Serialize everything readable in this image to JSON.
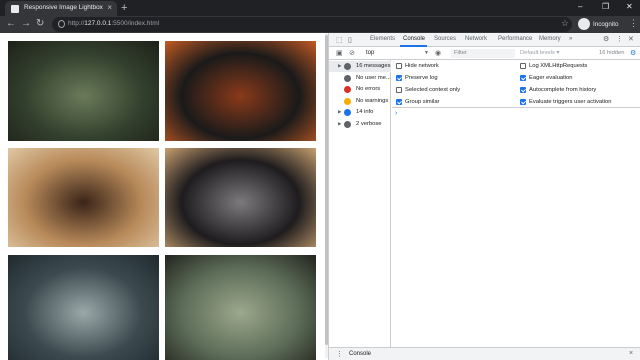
{
  "browser": {
    "tab_title": "Responsive Image Lightbox | Co",
    "tab_close": "×",
    "new_tab": "+",
    "window_controls": [
      "–",
      "❐",
      "✕"
    ],
    "nav": {
      "back": "←",
      "forward": "→",
      "reload": "↻"
    },
    "url_prefix": "http://",
    "url_host": "127.0.0.1",
    "url_rest": ":5500/index.html",
    "star_icon": "☆",
    "profile_label": "Incognito",
    "menu_icon": "⋮"
  },
  "gallery": {
    "images": [
      {
        "name": "backpack-photo",
        "colors": [
          "#33402e",
          "#6a7b59",
          "#1d2118"
        ]
      },
      {
        "name": "camera-on-leaves-photo",
        "colors": [
          "#1a1a1a",
          "#8a3a1a",
          "#c25a24"
        ]
      },
      {
        "name": "headphones-tablet-photo",
        "colors": [
          "#b88a5a",
          "#3a2418",
          "#e0c8a4"
        ]
      },
      {
        "name": "watch-photo",
        "colors": [
          "#1e1c1e",
          "#7c7a7c",
          "#c8a070"
        ]
      },
      {
        "name": "sneakers-in-stream-photo",
        "colors": [
          "#3c4a50",
          "#9aa8a8",
          "#1f2a2e"
        ]
      },
      {
        "name": "vintage-camera-on-log-photo",
        "colors": [
          "#5c6c58",
          "#9ca88c",
          "#22241e"
        ]
      }
    ]
  },
  "devtools": {
    "tabs": [
      "Elements",
      "Console",
      "Sources",
      "Network",
      "Performance",
      "Memory",
      "»"
    ],
    "active_tab": "Console",
    "context": "top",
    "filter_placeholder": "Filter",
    "levels": "Default levels ▾",
    "hidden_count": "16 hidden",
    "sidebar": [
      {
        "label": "16 messages",
        "icon": "list-icon",
        "color": "#5f6368"
      },
      {
        "label": "No user me...",
        "icon": "user-icon",
        "color": "#5f6368"
      },
      {
        "label": "No errors",
        "icon": "error-icon",
        "color": "#d93025"
      },
      {
        "label": "No warnings",
        "icon": "warning-icon",
        "color": "#f9ab00"
      },
      {
        "label": "14 info",
        "icon": "info-icon",
        "color": "#1a73e8"
      },
      {
        "label": "2 verbose",
        "icon": "verbose-icon",
        "color": "#5f6368"
      }
    ],
    "settings": {
      "left": [
        {
          "label": "Hide network",
          "checked": false
        },
        {
          "label": "Preserve log",
          "checked": true
        },
        {
          "label": "Selected context only",
          "checked": false
        },
        {
          "label": "Group similar",
          "checked": true
        }
      ],
      "right": [
        {
          "label": "Log XMLHttpRequests",
          "checked": false
        },
        {
          "label": "Eager evaluation",
          "checked": true
        },
        {
          "label": "Autocomplete from history",
          "checked": true
        },
        {
          "label": "Evaluate triggers user activation",
          "checked": true
        }
      ]
    },
    "prompt": "›",
    "drawer_label": "Console",
    "drawer_close": "×",
    "drawer_menu": "⋮"
  }
}
